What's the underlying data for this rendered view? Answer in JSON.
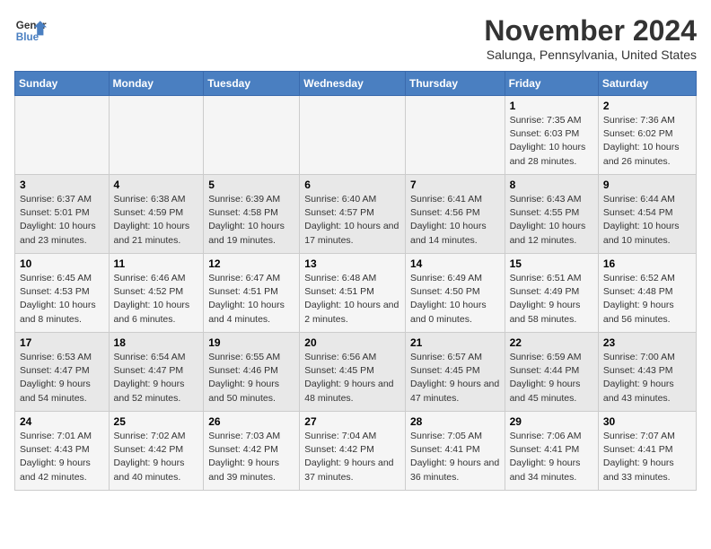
{
  "logo": {
    "line1": "General",
    "line2": "Blue"
  },
  "title": "November 2024",
  "location": "Salunga, Pennsylvania, United States",
  "days_of_week": [
    "Sunday",
    "Monday",
    "Tuesday",
    "Wednesday",
    "Thursday",
    "Friday",
    "Saturday"
  ],
  "weeks": [
    [
      {
        "day": "",
        "info": ""
      },
      {
        "day": "",
        "info": ""
      },
      {
        "day": "",
        "info": ""
      },
      {
        "day": "",
        "info": ""
      },
      {
        "day": "",
        "info": ""
      },
      {
        "day": "1",
        "info": "Sunrise: 7:35 AM\nSunset: 6:03 PM\nDaylight: 10 hours and 28 minutes."
      },
      {
        "day": "2",
        "info": "Sunrise: 7:36 AM\nSunset: 6:02 PM\nDaylight: 10 hours and 26 minutes."
      }
    ],
    [
      {
        "day": "3",
        "info": "Sunrise: 6:37 AM\nSunset: 5:01 PM\nDaylight: 10 hours and 23 minutes."
      },
      {
        "day": "4",
        "info": "Sunrise: 6:38 AM\nSunset: 4:59 PM\nDaylight: 10 hours and 21 minutes."
      },
      {
        "day": "5",
        "info": "Sunrise: 6:39 AM\nSunset: 4:58 PM\nDaylight: 10 hours and 19 minutes."
      },
      {
        "day": "6",
        "info": "Sunrise: 6:40 AM\nSunset: 4:57 PM\nDaylight: 10 hours and 17 minutes."
      },
      {
        "day": "7",
        "info": "Sunrise: 6:41 AM\nSunset: 4:56 PM\nDaylight: 10 hours and 14 minutes."
      },
      {
        "day": "8",
        "info": "Sunrise: 6:43 AM\nSunset: 4:55 PM\nDaylight: 10 hours and 12 minutes."
      },
      {
        "day": "9",
        "info": "Sunrise: 6:44 AM\nSunset: 4:54 PM\nDaylight: 10 hours and 10 minutes."
      }
    ],
    [
      {
        "day": "10",
        "info": "Sunrise: 6:45 AM\nSunset: 4:53 PM\nDaylight: 10 hours and 8 minutes."
      },
      {
        "day": "11",
        "info": "Sunrise: 6:46 AM\nSunset: 4:52 PM\nDaylight: 10 hours and 6 minutes."
      },
      {
        "day": "12",
        "info": "Sunrise: 6:47 AM\nSunset: 4:51 PM\nDaylight: 10 hours and 4 minutes."
      },
      {
        "day": "13",
        "info": "Sunrise: 6:48 AM\nSunset: 4:51 PM\nDaylight: 10 hours and 2 minutes."
      },
      {
        "day": "14",
        "info": "Sunrise: 6:49 AM\nSunset: 4:50 PM\nDaylight: 10 hours and 0 minutes."
      },
      {
        "day": "15",
        "info": "Sunrise: 6:51 AM\nSunset: 4:49 PM\nDaylight: 9 hours and 58 minutes."
      },
      {
        "day": "16",
        "info": "Sunrise: 6:52 AM\nSunset: 4:48 PM\nDaylight: 9 hours and 56 minutes."
      }
    ],
    [
      {
        "day": "17",
        "info": "Sunrise: 6:53 AM\nSunset: 4:47 PM\nDaylight: 9 hours and 54 minutes."
      },
      {
        "day": "18",
        "info": "Sunrise: 6:54 AM\nSunset: 4:47 PM\nDaylight: 9 hours and 52 minutes."
      },
      {
        "day": "19",
        "info": "Sunrise: 6:55 AM\nSunset: 4:46 PM\nDaylight: 9 hours and 50 minutes."
      },
      {
        "day": "20",
        "info": "Sunrise: 6:56 AM\nSunset: 4:45 PM\nDaylight: 9 hours and 48 minutes."
      },
      {
        "day": "21",
        "info": "Sunrise: 6:57 AM\nSunset: 4:45 PM\nDaylight: 9 hours and 47 minutes."
      },
      {
        "day": "22",
        "info": "Sunrise: 6:59 AM\nSunset: 4:44 PM\nDaylight: 9 hours and 45 minutes."
      },
      {
        "day": "23",
        "info": "Sunrise: 7:00 AM\nSunset: 4:43 PM\nDaylight: 9 hours and 43 minutes."
      }
    ],
    [
      {
        "day": "24",
        "info": "Sunrise: 7:01 AM\nSunset: 4:43 PM\nDaylight: 9 hours and 42 minutes."
      },
      {
        "day": "25",
        "info": "Sunrise: 7:02 AM\nSunset: 4:42 PM\nDaylight: 9 hours and 40 minutes."
      },
      {
        "day": "26",
        "info": "Sunrise: 7:03 AM\nSunset: 4:42 PM\nDaylight: 9 hours and 39 minutes."
      },
      {
        "day": "27",
        "info": "Sunrise: 7:04 AM\nSunset: 4:42 PM\nDaylight: 9 hours and 37 minutes."
      },
      {
        "day": "28",
        "info": "Sunrise: 7:05 AM\nSunset: 4:41 PM\nDaylight: 9 hours and 36 minutes."
      },
      {
        "day": "29",
        "info": "Sunrise: 7:06 AM\nSunset: 4:41 PM\nDaylight: 9 hours and 34 minutes."
      },
      {
        "day": "30",
        "info": "Sunrise: 7:07 AM\nSunset: 4:41 PM\nDaylight: 9 hours and 33 minutes."
      }
    ]
  ]
}
